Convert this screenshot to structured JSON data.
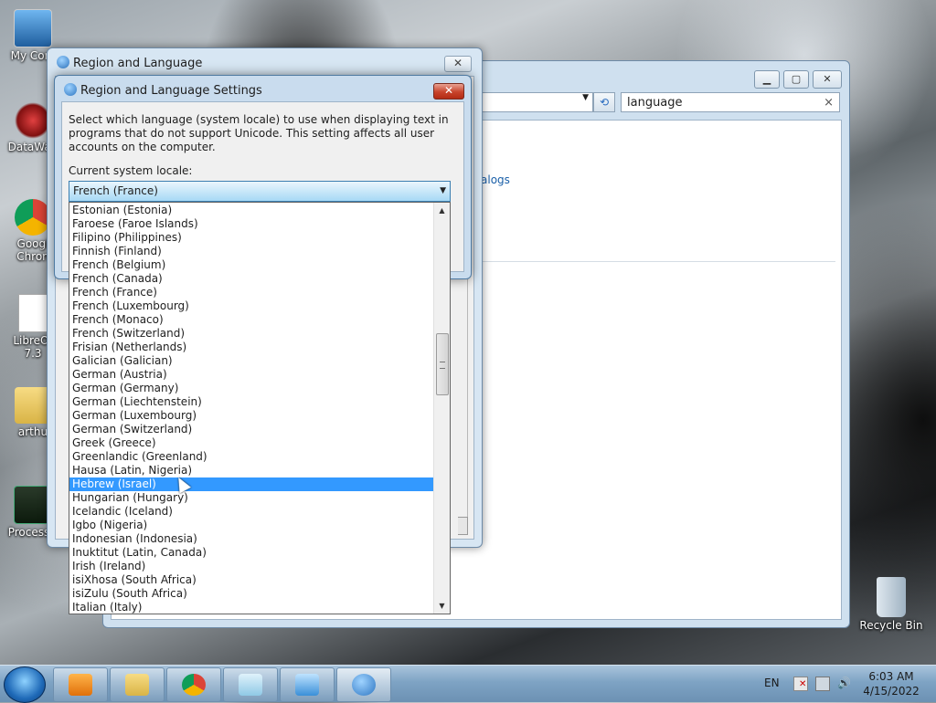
{
  "desktop": {
    "icons": [
      {
        "label": "My Com"
      },
      {
        "label": "DataWag"
      },
      {
        "label": "Googl\nChron"
      },
      {
        "label": "LibreOf\n7.3"
      },
      {
        "label": "arthu"
      },
      {
        "label": "ProcessH"
      },
      {
        "label": "Recycle Bin"
      }
    ]
  },
  "background_window": {
    "search_value": "language",
    "link_fragment": "alogs"
  },
  "outer_dialog": {
    "title": "Region and Language"
  },
  "inner_dialog": {
    "title": "Region and Language Settings",
    "description": "Select which language (system locale) to use when displaying text in programs that do not support Unicode. This setting affects all user accounts on the computer.",
    "locale_label": "Current system locale:",
    "locale_value": "French (France)",
    "close_label": "✕"
  },
  "locale_list": {
    "items": [
      "Estonian (Estonia)",
      "Faroese (Faroe Islands)",
      "Filipino (Philippines)",
      "Finnish (Finland)",
      "French (Belgium)",
      "French (Canada)",
      "French (France)",
      "French (Luxembourg)",
      "French (Monaco)",
      "French (Switzerland)",
      "Frisian (Netherlands)",
      "Galician (Galician)",
      "German (Austria)",
      "German (Germany)",
      "German (Liechtenstein)",
      "German (Luxembourg)",
      "German (Switzerland)",
      "Greek (Greece)",
      "Greenlandic (Greenland)",
      "Hausa (Latin, Nigeria)",
      "Hebrew (Israel)",
      "Hungarian (Hungary)",
      "Icelandic (Iceland)",
      "Igbo (Nigeria)",
      "Indonesian (Indonesia)",
      "Inuktitut (Latin, Canada)",
      "Irish (Ireland)",
      "isiXhosa (South Africa)",
      "isiZulu (South Africa)",
      "Italian (Italy)"
    ],
    "highlighted": "Hebrew (Israel)",
    "scroll_position": 0.36
  },
  "taskbar": {
    "language": "EN",
    "time": "6:03 AM",
    "date": "4/15/2022"
  }
}
